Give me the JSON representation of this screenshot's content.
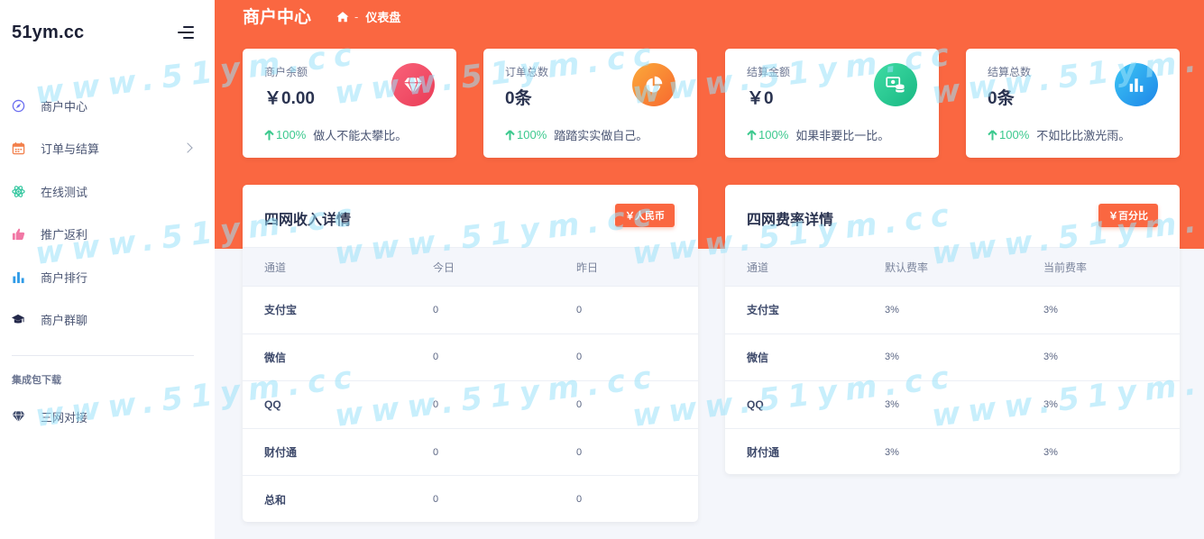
{
  "sidebar": {
    "brand": "51ym.cc",
    "items": [
      {
        "label": "商户中心",
        "icon": "compass-icon"
      },
      {
        "label": "订单与结算",
        "icon": "calendar-icon",
        "has_submenu": true
      },
      {
        "label": "在线测试",
        "icon": "atom-icon"
      },
      {
        "label": "推广返利",
        "icon": "thumbs-up-icon"
      },
      {
        "label": "商户排行",
        "icon": "bar-chart-icon"
      },
      {
        "label": "商户群聊",
        "icon": "graduation-cap-icon"
      }
    ],
    "section_title": "集成包下载",
    "section_items": [
      {
        "label": "三网对接",
        "icon": "diamond-icon"
      }
    ]
  },
  "header": {
    "title": "商户中心",
    "breadcrumb": {
      "separator": "-",
      "current": "仪表盘",
      "home_icon": "home-icon"
    }
  },
  "stats": [
    {
      "label": "商户余额",
      "value": "￥0.00",
      "pct": "100%",
      "note": "做人不能太攀比。",
      "icon": "diamond-icon"
    },
    {
      "label": "订单总数",
      "value": "0条",
      "pct": "100%",
      "note": "踏踏实实做自己。",
      "icon": "pie-chart-icon"
    },
    {
      "label": "结算金额",
      "value": "￥0",
      "pct": "100%",
      "note": "如果非要比一比。",
      "icon": "money-icon"
    },
    {
      "label": "结算总数",
      "value": "0条",
      "pct": "100%",
      "note": "不如比比激光雨。",
      "icon": "bar-chart-icon"
    }
  ],
  "income_table": {
    "title": "四网收入详情",
    "badge": "￥人民币",
    "columns": [
      "通道",
      "今日",
      "昨日"
    ],
    "rows": [
      [
        "支付宝",
        "0",
        "0"
      ],
      [
        "微信",
        "0",
        "0"
      ],
      [
        "QQ",
        "0",
        "0"
      ],
      [
        "财付通",
        "0",
        "0"
      ],
      [
        "总和",
        "0",
        "0"
      ]
    ]
  },
  "rate_table": {
    "title": "四网费率详情",
    "badge": "￥百分比",
    "columns": [
      "通道",
      "默认费率",
      "当前费率"
    ],
    "rows": [
      [
        "支付宝",
        "3%",
        "3%"
      ],
      [
        "微信",
        "3%",
        "3%"
      ],
      [
        "QQ",
        "3%",
        "3%"
      ],
      [
        "财付通",
        "3%",
        "3%"
      ]
    ]
  },
  "watermark": "www.51ym.cc",
  "colors": {
    "accent": "#fa6741",
    "up": "#3cc98e",
    "text_dark": "#2a3350"
  }
}
